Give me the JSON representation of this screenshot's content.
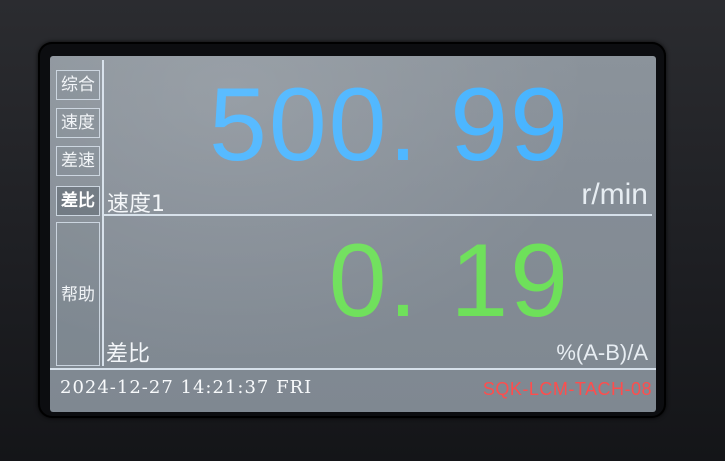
{
  "nav": {
    "tabs": [
      {
        "label": "综合"
      },
      {
        "label": "速度"
      },
      {
        "label": "差速"
      },
      {
        "label": "差比"
      },
      {
        "label": "帮助"
      }
    ],
    "active_index": 3
  },
  "speed_panel": {
    "label": "速度1",
    "value": "500. 99",
    "unit": "r/min",
    "value_color": "#45b3ff"
  },
  "ratio_panel": {
    "label": "差比",
    "value": "0. 19",
    "unit": "%(A-B)/A",
    "value_color": "#6ee05a"
  },
  "footer": {
    "datetime": "2024-12-27 14:21:37 FRI",
    "model": "SQK-LCM-TACH-08",
    "model_color": "#ff4d4d"
  }
}
